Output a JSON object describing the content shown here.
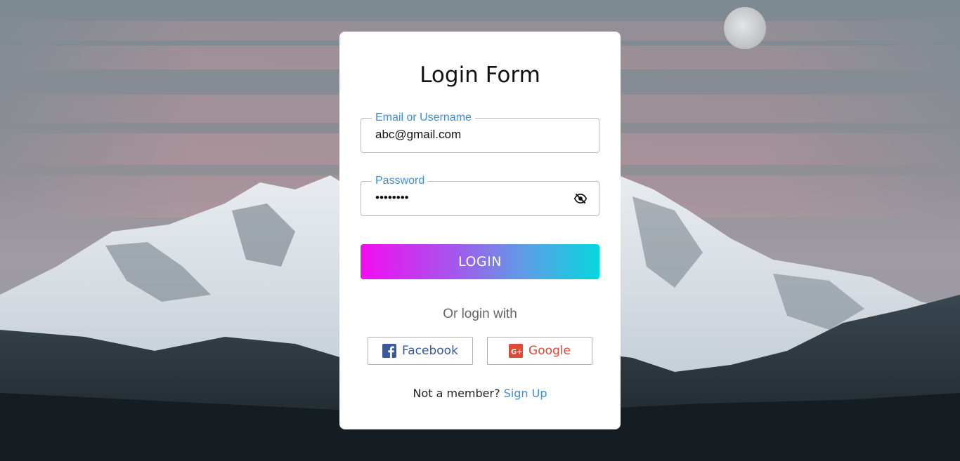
{
  "form": {
    "title": "Login Form",
    "email": {
      "label": "Email or Username",
      "value": "abc@gmail.com"
    },
    "password": {
      "label": "Password",
      "value": "........",
      "toggle_icon": "eye-slash-icon"
    },
    "login_button": "LOGIN",
    "or_text": "Or login with",
    "social": {
      "facebook": {
        "label": "Facebook",
        "icon": "facebook-icon",
        "color": "#3b5998"
      },
      "google": {
        "label": "Google",
        "icon": "google-plus-icon",
        "color": "#dc4a38"
      }
    },
    "signup_prompt": "Not a member?",
    "signup_link": "Sign Up"
  },
  "colors": {
    "accent": "#3d8fd6",
    "gradient_start": "#f30cf1",
    "gradient_end": "#06d6de"
  }
}
